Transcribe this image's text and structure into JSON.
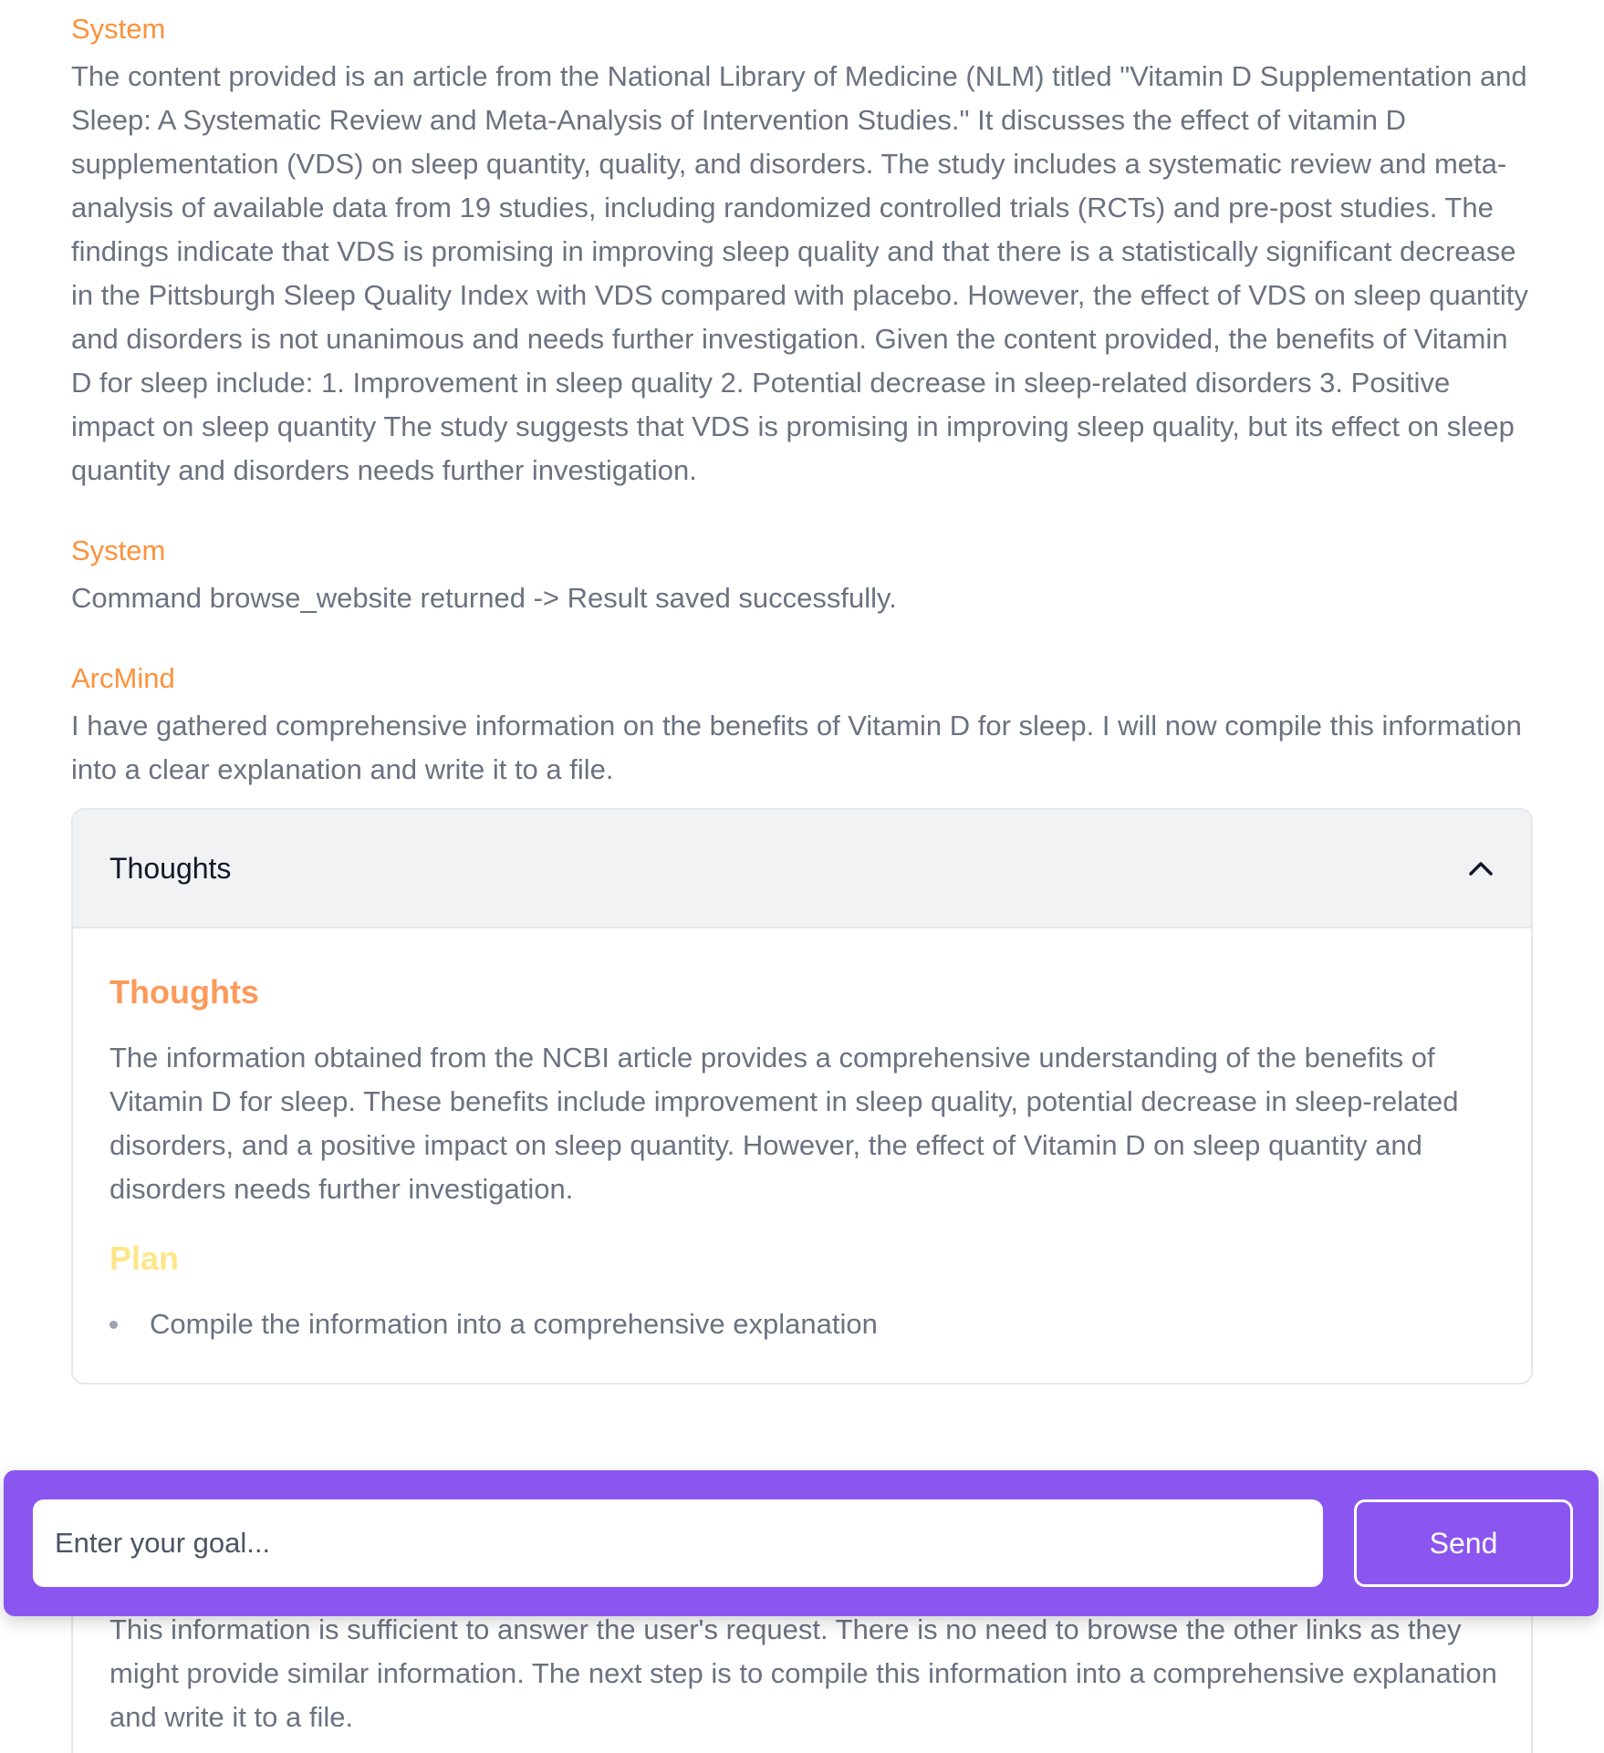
{
  "messages": [
    {
      "author": "System",
      "text": "The content provided is an article from the National Library of Medicine (NLM) titled \"Vitamin D Supplementation and Sleep: A Systematic Review and Meta-Analysis of Intervention Studies.\" It discusses the effect of vitamin D supplementation (VDS) on sleep quantity, quality, and disorders. The study includes a systematic review and meta-analysis of available data from 19 studies, including randomized controlled trials (RCTs) and pre-post studies. The findings indicate that VDS is promising in improving sleep quality and that there is a statistically significant decrease in the Pittsburgh Sleep Quality Index with VDS compared with placebo. However, the effect of VDS on sleep quantity and disorders is not unanimous and needs further investigation. Given the content provided, the benefits of Vitamin D for sleep include: 1. Improvement in sleep quality 2. Potential decrease in sleep-related disorders 3. Positive impact on sleep quantity The study suggests that VDS is promising in improving sleep quality, but its effect on sleep quantity and disorders needs further investigation."
    },
    {
      "author": "System",
      "text": "Command browse_website returned -> Result saved successfully."
    },
    {
      "author": "ArcMind",
      "text": "I have gathered comprehensive information on the benefits of Vitamin D for sleep. I will now compile this information into a clear explanation and write it to a file."
    }
  ],
  "thoughts_panel": {
    "header": "Thoughts",
    "thoughts_heading": "Thoughts",
    "thoughts_text": "The information obtained from the NCBI article provides a comprehensive understanding of the benefits of Vitamin D for sleep. These benefits include improvement in sleep quality, potential decrease in sleep-related disorders, and a positive impact on sleep quantity. However, the effect of Vitamin D on sleep quantity and disorders needs further investigation.",
    "plan_heading": "Plan",
    "plan_items": [
      "Compile the information into a comprehensive explanation"
    ],
    "reasoning_text": "This information is sufficient to answer the user's request. There is no need to browse the other links as they might provide similar information. The next step is to compile this information into a comprehensive explanation and write it to a file."
  },
  "input_bar": {
    "placeholder": "Enter your goal...",
    "send_label": "Send"
  },
  "colors": {
    "author": "#fb923c",
    "body_text": "#6b7280",
    "plan_heading": "#fde68a",
    "input_bar_bg": "#8b55f0"
  },
  "icons": {
    "collapse": "chevron-up-icon"
  }
}
